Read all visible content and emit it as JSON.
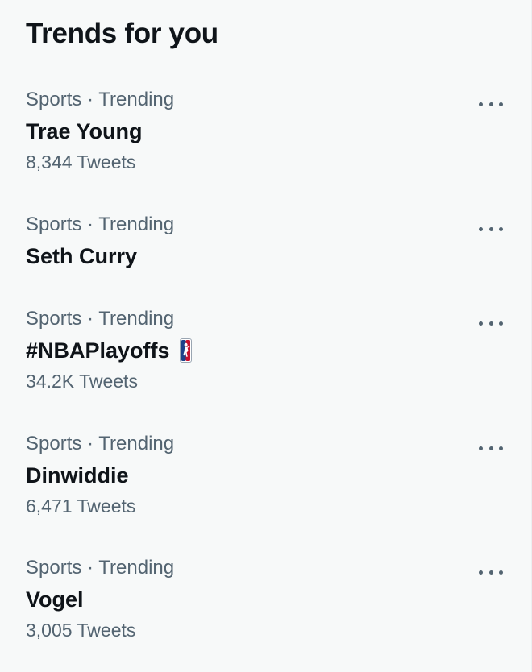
{
  "panel": {
    "title": "Trends for you"
  },
  "trends": [
    {
      "meta": "Sports · Trending",
      "name": "Trae Young",
      "count": "8,344 Tweets"
    },
    {
      "meta": "Sports · Trending",
      "name": "Seth Curry",
      "count": ""
    },
    {
      "meta": "Sports · Trending",
      "name": "#NBAPlayoffs",
      "count": "34.2K Tweets",
      "icon": "nba-logo-icon"
    },
    {
      "meta": "Sports · Trending",
      "name": "Dinwiddie",
      "count": "6,471 Tweets"
    },
    {
      "meta": "Sports · Trending",
      "name": "Vogel",
      "count": "3,005 Tweets"
    }
  ],
  "icons": {
    "more": "more-options-icon"
  },
  "colors": {
    "background": "#f7f9f9",
    "primary_text": "#0f1419",
    "secondary_text": "#536471",
    "nba_blue": "#1d428a",
    "nba_red": "#c8102e"
  }
}
